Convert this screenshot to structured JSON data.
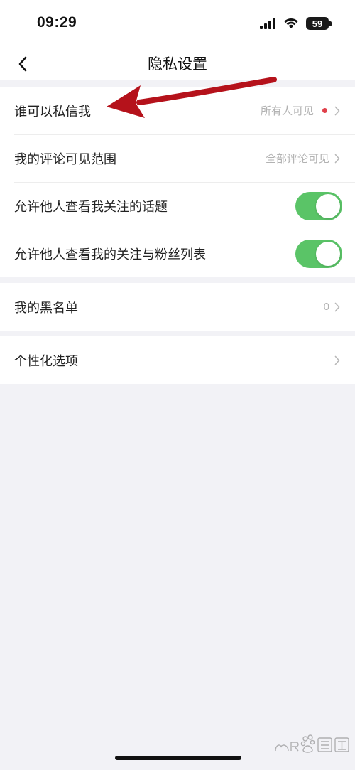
{
  "status_bar": {
    "time": "09:29",
    "battery_level": "59",
    "icons": [
      "signal-icon",
      "wifi-icon",
      "battery-icon"
    ]
  },
  "nav": {
    "title": "隐私设置",
    "back_icon": "chevron-left-icon"
  },
  "settings": {
    "group1": [
      {
        "label": "谁可以私信我",
        "value": "所有人可见",
        "has_dot": true
      },
      {
        "label": "我的评论可见范围",
        "value": "全部评论可见"
      },
      {
        "label": "允许他人查看我关注的话题",
        "toggle": true
      },
      {
        "label": "允许他人查看我的关注与粉丝列表",
        "toggle": true
      }
    ],
    "group2": [
      {
        "label": "我的黑名单",
        "value": "0"
      }
    ],
    "group3": [
      {
        "label": "个性化选项",
        "value": ""
      }
    ]
  },
  "colors": {
    "toggle_on": "#5ac467",
    "red_dot": "#e0404a",
    "annotation_arrow": "#b5121b",
    "page_bg": "#f2f2f6"
  },
  "watermark": {
    "text": "Bai 经验",
    "icon": "baidu-paw-icon"
  }
}
